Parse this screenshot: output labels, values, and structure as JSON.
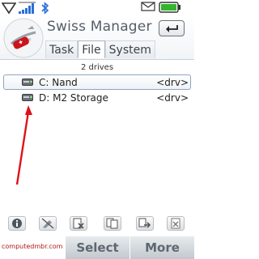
{
  "app": {
    "title": "Swiss Manager"
  },
  "tabs": [
    {
      "label": "Task",
      "active": false
    },
    {
      "label": "File",
      "active": true
    },
    {
      "label": "System",
      "active": false
    }
  ],
  "file_panel": {
    "count_label": "2 drives",
    "drives": [
      {
        "name": "C: Nand",
        "type": "<drv>",
        "selected": true
      },
      {
        "name": "D: M2 Storage",
        "type": "<drv>",
        "selected": false
      }
    ]
  },
  "toolbar": {
    "icons": [
      "info-icon",
      "disabled-edit-icon",
      "delete-doc-icon",
      "copy-icon",
      "move-icon",
      "close-doc-icon"
    ]
  },
  "softkeys": {
    "select": "Select",
    "more": "More"
  },
  "watermark": "computedmbr.com",
  "colors": {
    "annotation_arrow": "#e0101a",
    "softkey_text": "#5f6770"
  }
}
